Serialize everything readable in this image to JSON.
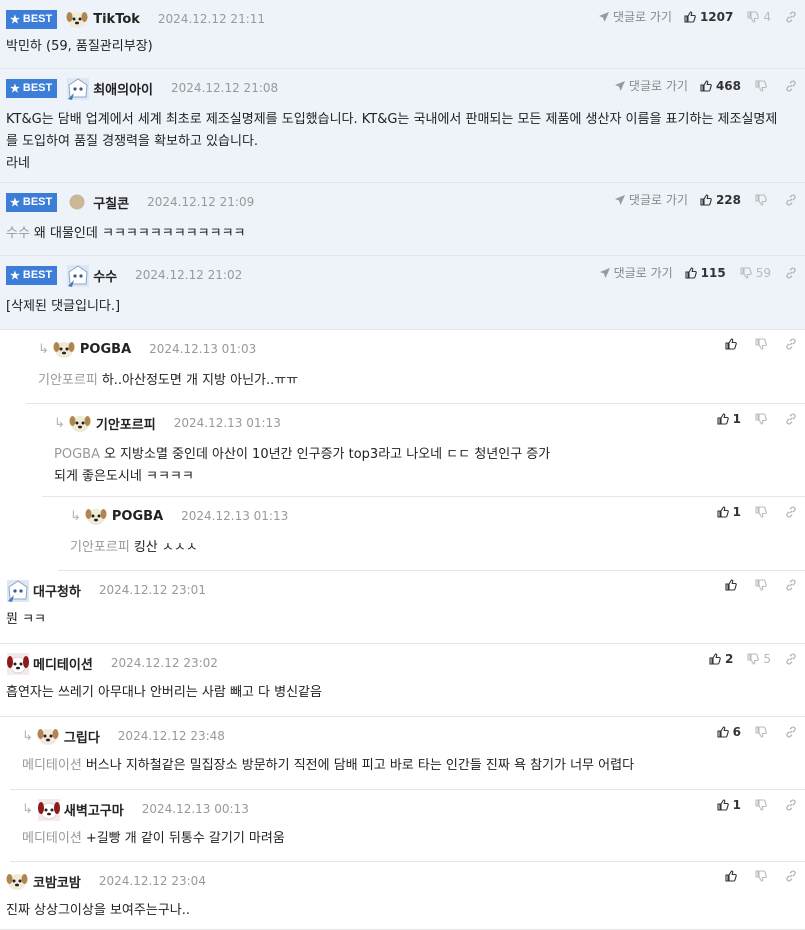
{
  "labels": {
    "best": "BEST",
    "reply_to": "댓글로 가기"
  },
  "comments": [
    {
      "best": true,
      "nick": "TikTok",
      "date": "2024.12.12 21:11",
      "up": "1207",
      "down": "4",
      "mention": "",
      "text": "박민하 (59, 품질관리부장)",
      "avatar": "puppy-avatar"
    },
    {
      "best": true,
      "nick": "최애의아이",
      "date": "2024.12.12 21:08",
      "up": "468",
      "down": "",
      "mention": "",
      "text": "KT&G는 담배 업계에서 세계 최초로 제조실명제를 도입했습니다. KT&G는 국내에서 판매되는 모든 제품에 생산자 이름을 표기하는 제조실명제를 도입하여 품질 경쟁력을 확보하고 있습니다.\n라네",
      "avatar": "anime-avatar"
    },
    {
      "best": true,
      "nick": "구칠콘",
      "date": "2024.12.12 21:09",
      "up": "228",
      "down": "",
      "mention": "수수",
      "text": "왜 대물인데 ㅋㅋㅋㅋㅋㅋㅋㅋㅋㅋㅋㅋ",
      "avatar": "circle-avatar"
    },
    {
      "best": true,
      "nick": "수수",
      "date": "2024.12.12 21:02",
      "up": "115",
      "down": "59",
      "mention": "",
      "text": "[삭제된 댓글입니다.]",
      "avatar": "anime-avatar"
    },
    {
      "best": false,
      "reply": true,
      "nick": "POGBA",
      "date": "2024.12.13 01:03",
      "up": "",
      "down": "",
      "mention": "기안포르피",
      "text": "하..아산정도면 개 지방 아닌가..ㅠㅠ",
      "avatar": "puppy-avatar"
    },
    {
      "best": false,
      "reply": true,
      "nick": "기안포르피",
      "date": "2024.12.13 01:13",
      "up": "1",
      "down": "",
      "mention": "POGBA",
      "text": "오 지방소멸 중인데 아산이 10년간 인구증가 top3라고 나오네 ㄷㄷ 청년인구 증가\n되게 좋은도시네 ㅋㅋㅋㅋ",
      "avatar": "puppy-avatar"
    },
    {
      "best": false,
      "reply": true,
      "nick": "POGBA",
      "date": "2024.12.13 01:13",
      "up": "1",
      "down": "",
      "mention": "기안포르피",
      "text": "킹산 ㅅㅅㅅ",
      "avatar": "puppy-avatar"
    },
    {
      "best": false,
      "reply": false,
      "nick": "대구청하",
      "date": "2024.12.12 23:01",
      "up": "",
      "down": "",
      "mention": "",
      "text": "뭔 ㅋㅋ",
      "avatar": "anime-avatar"
    },
    {
      "best": false,
      "reply": false,
      "nick": "메디테이션",
      "date": "2024.12.12 23:02",
      "up": "2",
      "down": "5",
      "mention": "",
      "text": "흡연자는 쓰레기 아무대나 안버리는 사람 빼고 다 병신같음",
      "avatar": "red-dog-avatar"
    },
    {
      "best": false,
      "reply": true,
      "nick": "그립다",
      "date": "2024.12.12 23:48",
      "up": "6",
      "down": "",
      "mention": "메디테이션",
      "text": "버스나 지하철같은 밀집장소 방문하기 직전에 담배 피고 바로 타는 인간들 진짜 욕 참기가 너무 어렵다",
      "avatar": "puppy-avatar"
    },
    {
      "best": false,
      "reply": true,
      "nick": "새벽고구마",
      "date": "2024.12.13 00:13",
      "up": "1",
      "down": "",
      "mention": "메디테이션",
      "text": "+길빵 개 같이 뒤통수 갈기기 마려움",
      "avatar": "red-dog-avatar"
    },
    {
      "best": false,
      "reply": false,
      "nick": "코밤코밤",
      "date": "2024.12.12 23:04",
      "up": "",
      "down": "",
      "mention": "",
      "text": "진짜 상상그이상을 보여주는구나..",
      "avatar": "puppy-avatar"
    }
  ]
}
